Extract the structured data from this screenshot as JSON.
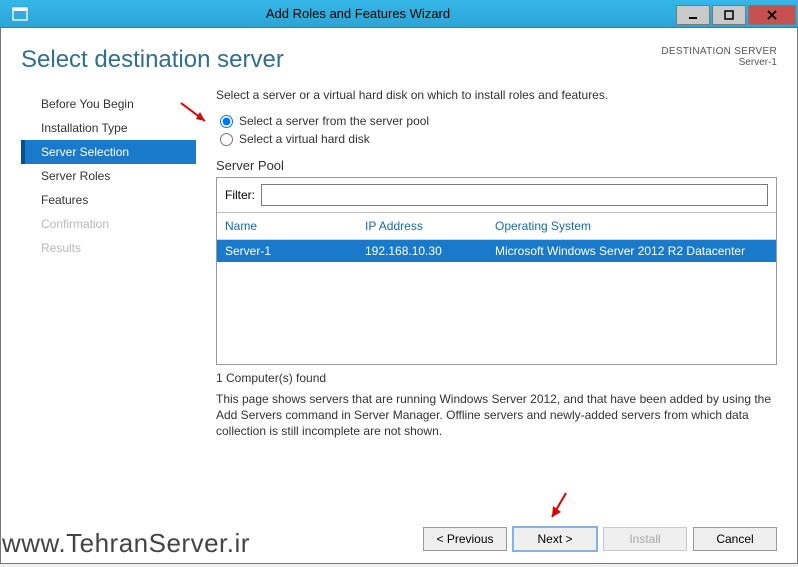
{
  "titlebar": {
    "title": "Add Roles and Features Wizard"
  },
  "header": {
    "page_title": "Select destination server",
    "dest_label": "DESTINATION SERVER",
    "dest_value": "Server-1"
  },
  "sidebar": {
    "items": [
      {
        "label": "Before You Begin",
        "state": "normal"
      },
      {
        "label": "Installation Type",
        "state": "normal"
      },
      {
        "label": "Server Selection",
        "state": "selected"
      },
      {
        "label": "Server Roles",
        "state": "normal"
      },
      {
        "label": "Features",
        "state": "normal"
      },
      {
        "label": "Confirmation",
        "state": "disabled"
      },
      {
        "label": "Results",
        "state": "disabled"
      }
    ]
  },
  "main": {
    "instruction": "Select a server or a virtual hard disk on which to install roles and features.",
    "radio1": "Select a server from the server pool",
    "radio2": "Select a virtual hard disk",
    "pool_label": "Server Pool",
    "filter_label": "Filter:",
    "filter_value": "",
    "columns": {
      "name": "Name",
      "ip": "IP Address",
      "os": "Operating System"
    },
    "rows": [
      {
        "name": "Server-1",
        "ip": "192.168.10.30",
        "os": "Microsoft Windows Server 2012 R2 Datacenter"
      }
    ],
    "found": "1 Computer(s) found",
    "description": "This page shows servers that are running Windows Server 2012, and that have been added by using the Add Servers command in Server Manager. Offline servers and newly-added servers from which data collection is still incomplete are not shown."
  },
  "footer": {
    "previous": "< Previous",
    "next": "Next >",
    "install": "Install",
    "cancel": "Cancel"
  },
  "watermark": "www.TehranServer.ir"
}
